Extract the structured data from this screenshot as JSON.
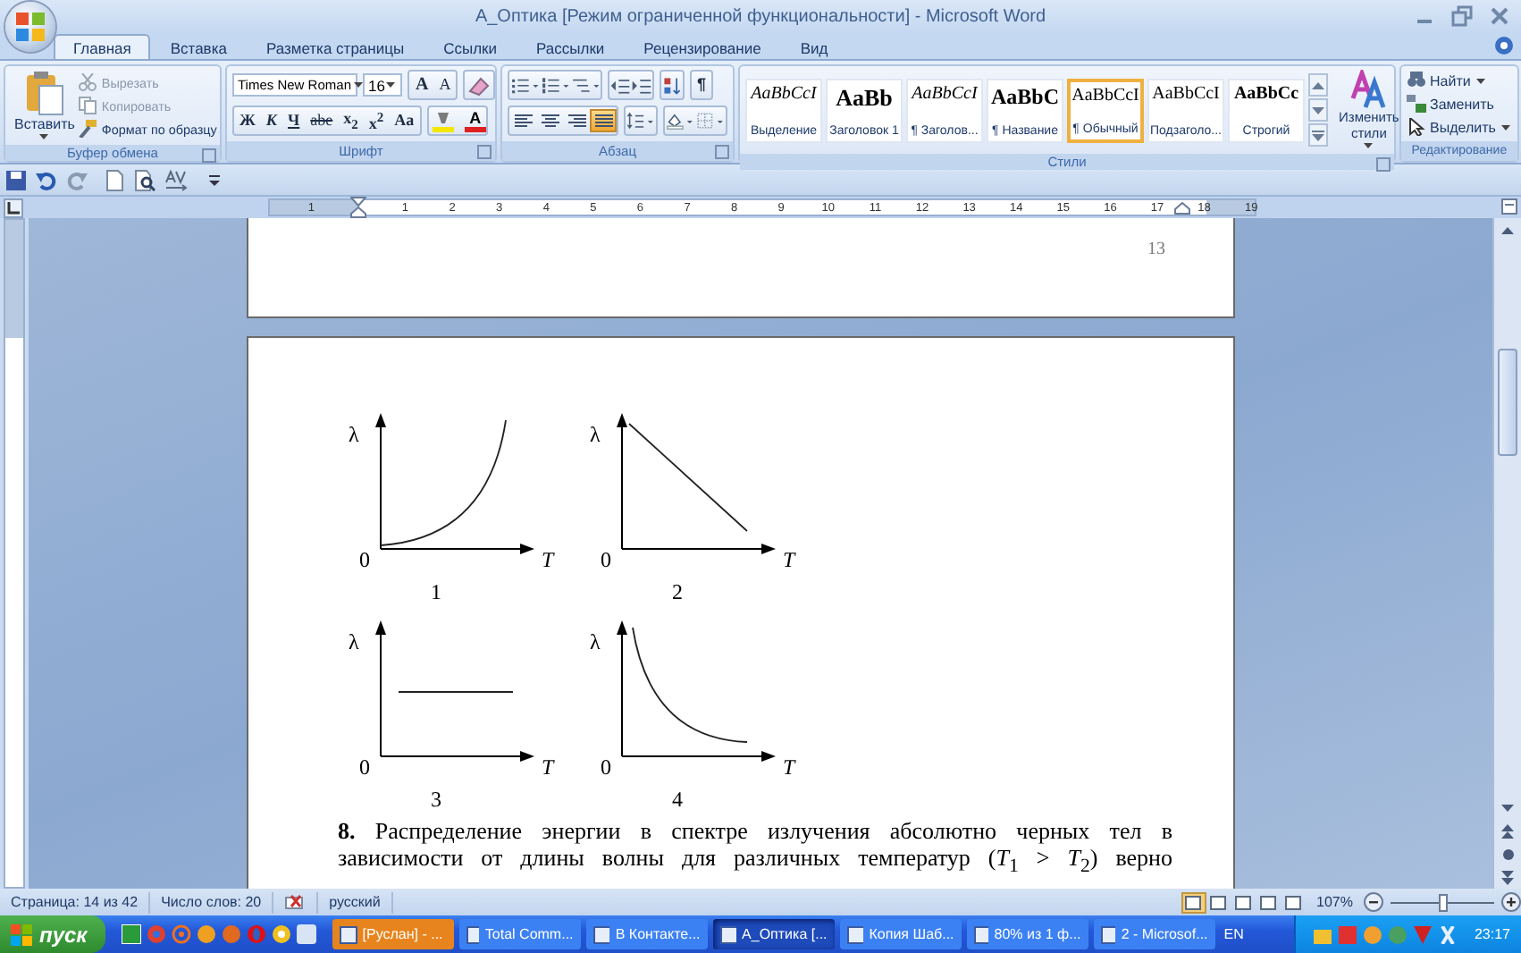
{
  "window": {
    "title": "А_Оптика [Режим ограниченной функциональности] - Microsoft Word"
  },
  "tabs": [
    {
      "label": "Главная",
      "selected": true
    },
    {
      "label": "Вставка",
      "selected": false
    },
    {
      "label": "Разметка страницы",
      "selected": false
    },
    {
      "label": "Ссылки",
      "selected": false
    },
    {
      "label": "Рассылки",
      "selected": false
    },
    {
      "label": "Рецензирование",
      "selected": false
    },
    {
      "label": "Вид",
      "selected": false
    }
  ],
  "clipboard": {
    "paste": "Вставить",
    "group": "Буфер обмена",
    "actions": [
      {
        "kind": "cut",
        "label": "Вырезать",
        "disabled": true
      },
      {
        "kind": "copy",
        "label": "Копировать",
        "disabled": true
      },
      {
        "kind": "painter",
        "label": "Формат по образцу",
        "disabled": false
      }
    ]
  },
  "font": {
    "name": "Times New Roman",
    "size": "16",
    "group": "Шрифт",
    "grow": "A",
    "shrink": "A",
    "format_buttons": [
      {
        "kind": "bold",
        "label": "Ж"
      },
      {
        "kind": "italic",
        "label": "К"
      },
      {
        "kind": "underline",
        "label": "Ч"
      },
      {
        "kind": "strike",
        "label": "abe"
      },
      {
        "kind": "sub",
        "label": "x$_{2}$"
      },
      {
        "kind": "sup",
        "label": "x$^{2}$"
      },
      {
        "kind": "case",
        "label": "Aa"
      }
    ],
    "font_color": "A"
  },
  "paragraph": {
    "group": "Абзац",
    "pilcrow": "¶",
    "align": [
      {
        "kind": "left",
        "selected": false
      },
      {
        "kind": "center",
        "selected": false
      },
      {
        "kind": "right",
        "selected": false
      },
      {
        "kind": "justify",
        "selected": true
      }
    ]
  },
  "styles": {
    "group": "Стили",
    "change": "Изменить стили",
    "items": [
      {
        "sample": "AaBbCcI",
        "kind": "italic",
        "label": "Выделение",
        "selected": false
      },
      {
        "sample": "AaBb",
        "kind": "heading",
        "label": "Заголовок 1",
        "selected": false
      },
      {
        "sample": "AaBbCcI",
        "kind": "italic",
        "label": "¶ Заголов...",
        "selected": false
      },
      {
        "sample": "AaBbC",
        "kind": "title",
        "label": "¶ Название",
        "selected": false
      },
      {
        "sample": "AaBbCcI",
        "kind": "plain",
        "label": "¶ Обычный",
        "selected": true
      },
      {
        "sample": "AaBbCcI",
        "kind": "plain",
        "label": "Подзаголо...",
        "selected": false
      },
      {
        "sample": "AaBbCc",
        "kind": "bold",
        "label": "Строгий",
        "selected": false
      }
    ]
  },
  "editing": {
    "group": "Редактирование",
    "actions": [
      {
        "kind": "find",
        "label": "Найти"
      },
      {
        "kind": "replace",
        "label": "Заменить"
      },
      {
        "kind": "select",
        "label": "Выделить"
      }
    ]
  },
  "ruler": {
    "marks": [
      "1",
      "1",
      "2",
      "3",
      "4",
      "5",
      "6",
      "7",
      "8",
      "9",
      "10",
      "11",
      "12",
      "13",
      "14",
      "15",
      "16",
      "17",
      "18",
      "19"
    ]
  },
  "document": {
    "page_number": "13",
    "graphs": [
      {
        "kind": "rising",
        "y_label": "λ",
        "origin": "0",
        "x_label": "T",
        "caption": "1"
      },
      {
        "kind": "falling-line",
        "y_label": "λ",
        "origin": "0",
        "x_label": "T",
        "caption": "2"
      },
      {
        "kind": "flat",
        "y_label": "λ",
        "origin": "0",
        "x_label": "T",
        "caption": "3"
      },
      {
        "kind": "falling-curve",
        "y_label": "λ",
        "origin": "0",
        "x_label": "T",
        "caption": "4"
      }
    ],
    "paragraph": "**8.** Распределение энергии в спектре излучения абсолютно черных тел в",
    "cut_line": "зависимости от длины волны для различных температур (*T*$_{1}$ > *T*$_{2}$) верно"
  },
  "status_bar": {
    "page": "Страница: 14 из 42",
    "words": "Число слов: 20",
    "language": "русский",
    "zoom": "107%",
    "zoom_level": {
      "level": 0.5
    },
    "views": [
      {
        "selected": true
      },
      {
        "selected": false
      },
      {
        "selected": false
      },
      {
        "selected": false
      },
      {
        "selected": false
      }
    ]
  },
  "taskbar": {
    "start": "пуск",
    "language": "EN",
    "clock": "23:17",
    "windows": [
      {
        "label": "[Руслан] - ...",
        "attention": true,
        "selected": false
      },
      {
        "label": "Total Comm...",
        "attention": false,
        "selected": false
      },
      {
        "label": "В Контакте...",
        "attention": false,
        "selected": false
      },
      {
        "label": "А_Оптика [...",
        "attention": false,
        "selected": true
      },
      {
        "label": "Копия Шаб...",
        "attention": false,
        "selected": false
      },
      {
        "label": "80% из 1 ф...",
        "attention": false,
        "selected": false
      },
      {
        "label": "2 - Microsof...",
        "attention": false,
        "selected": false
      }
    ]
  }
}
